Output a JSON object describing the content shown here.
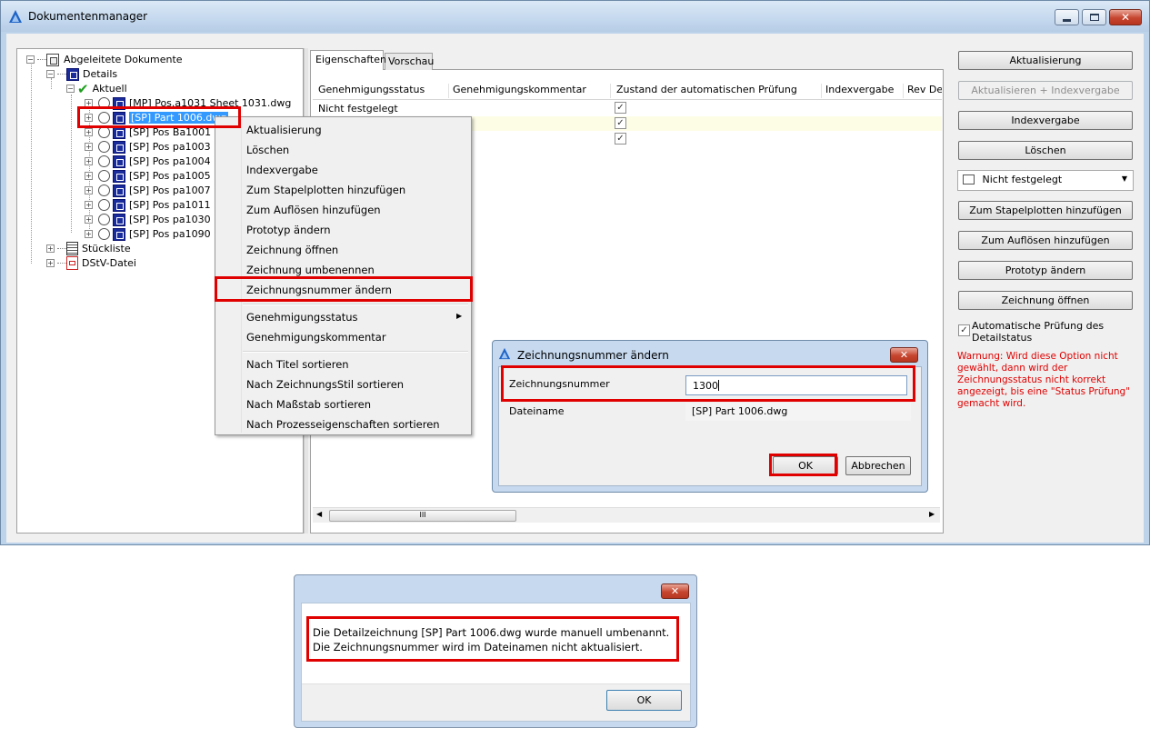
{
  "window": {
    "title": "Dokumentenmanager"
  },
  "tree": {
    "root": "Abgeleitete Dokumente",
    "details": "Details",
    "current": "Aktuell",
    "items": [
      "[MP] Pos.a1031 Sheet 1031.dwg",
      "[SP] Part 1006.dwg",
      "[SP] Pos Ba1001",
      "[SP] Pos pa1003",
      "[SP] Pos pa1004",
      "[SP] Pos pa1005",
      "[SP] Pos pa1007",
      "[SP] Pos pa1011",
      "[SP] Pos pa1030",
      "[SP] Pos pa1090"
    ],
    "bom": "Stückliste",
    "dstv": "DStV-Datei"
  },
  "tabs": {
    "properties": "Eigenschaften",
    "preview": "Vorschau"
  },
  "grid": {
    "columns": [
      "Genehmigungsstatus",
      "Genehmigungskommentar",
      "Zustand der automatischen Prüfung",
      "Indexvergabe",
      "Rev De"
    ],
    "row0_status": "Nicht festgelegt",
    "scroll_grip": "III"
  },
  "context_menu": {
    "items": [
      "Aktualisierung",
      "Löschen",
      "Indexvergabe",
      "Zum Stapelplotten hinzufügen",
      "Zum Auflösen hinzufügen",
      "Prototyp ändern",
      "Zeichnung öffnen",
      "Zeichnung umbenennen",
      "Zeichnungsnummer ändern"
    ],
    "group2": [
      "Genehmigungsstatus",
      "Genehmigungskommentar"
    ],
    "group3": [
      "Nach Titel sortieren",
      "Nach ZeichnungsStil sortieren",
      "Nach Maßstab sortieren",
      "Nach Prozesseigenschaften sortieren"
    ]
  },
  "right_panel": {
    "buttons": [
      "Aktualisierung",
      "Aktualisieren + Indexvergabe",
      "Indexvergabe",
      "Löschen"
    ],
    "status_value": "Nicht festgelegt",
    "buttons2": [
      "Zum Stapelplotten hinzufügen",
      "Zum Auflösen hinzufügen",
      "Prototyp ändern",
      "Zeichnung öffnen"
    ],
    "auto_check_label": "Automatische Prüfung des Detailstatus",
    "warning": "Warnung: Wird diese Option nicht gewählt, dann wird der Zeichnungsstatus nicht korrekt angezeigt, bis eine \"Status Prüfung\" gemacht wird.",
    "warning_color": "#e00000"
  },
  "number_dialog": {
    "title": "Zeichnungsnummer ändern",
    "number_label": "Zeichnungsnummer",
    "number_value": "1300",
    "file_label": "Dateiname",
    "file_value": "[SP] Part 1006.dwg",
    "ok": "OK",
    "cancel": "Abbrechen"
  },
  "message_dialog": {
    "text": "Die Detailzeichnung [SP] Part 1006.dwg wurde manuell umbenannt. Die Zeichnungsnummer wird im Dateinamen nicht aktualisiert.",
    "ok": "OK"
  },
  "colors": {
    "highlight_red": "#e00000",
    "selection_blue": "#3399ff",
    "tree_icon_blue": "#1a2c9c"
  }
}
